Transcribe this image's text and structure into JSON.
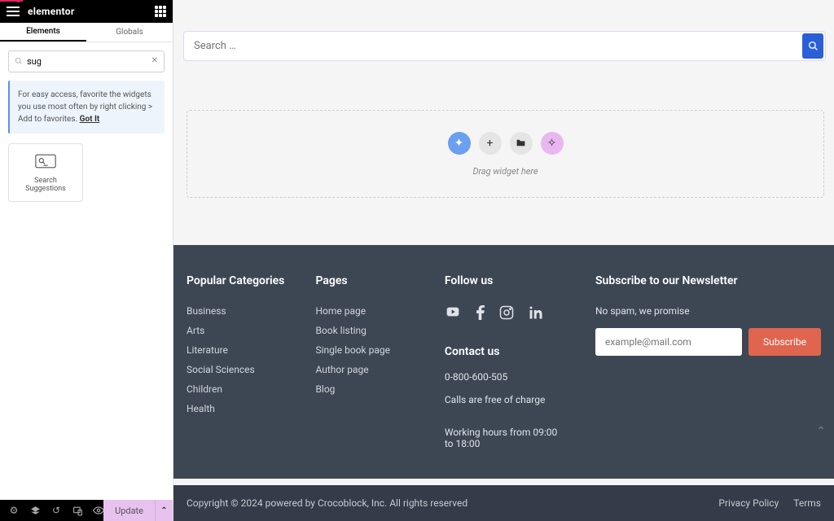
{
  "brand": "elementor",
  "tabs": {
    "elements": "Elements",
    "globals": "Globals"
  },
  "sidebar_search": {
    "value": "sug",
    "placeholder": ""
  },
  "tip": {
    "text": "For easy access, favorite the widgets you use most often by right clicking > Add to favorites. ",
    "gotit": "Got It"
  },
  "widget": {
    "label": "Search Suggestions"
  },
  "bottom": {
    "update": "Update"
  },
  "preview": {
    "search_placeholder": "Search …",
    "drag_hint": "Drag widget here"
  },
  "footer": {
    "cat_title": "Popular Categories",
    "categories": [
      "Business",
      "Arts",
      "Literature",
      "Social Sciences",
      "Children",
      "Health"
    ],
    "pages_title": "Pages",
    "pages": [
      "Home page",
      "Book listing",
      "Single book page",
      "Author page",
      "Blog"
    ],
    "follow_title": "Follow us",
    "contact_title": "Contact us",
    "phone": "0-800-600-505",
    "calls": "Calls are free of charge",
    "hours": "Working hours from 09:00 to 18:00",
    "sub_title": "Subscribe to our Newsletter",
    "sub_note": "No spam, we promise",
    "email_placeholder": "example@mail.com",
    "subscribe": "Subscribe",
    "copyright": "Copyright © 2024 powered by Crocoblock, Inc. All rights reserved",
    "privacy": "Privacy Policy",
    "terms": "Terms"
  }
}
